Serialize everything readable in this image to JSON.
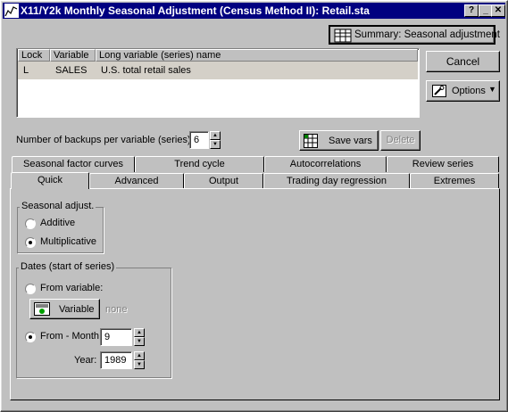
{
  "window": {
    "title": "X11/Y2k Monthly Seasonal Adjustment (Census Method II): Retail.sta",
    "help_btn": "?",
    "minimize_btn": "_",
    "close_btn": "✕"
  },
  "buttons": {
    "summary": "Summary:  Seasonal adjustment",
    "cancel": "Cancel",
    "options": "Options",
    "save_vars": "Save vars",
    "delete": "Delete",
    "variable": "Variable"
  },
  "table": {
    "headers": [
      "Lock",
      "Variable",
      "Long variable (series) name"
    ],
    "rows": [
      {
        "lock": "L",
        "variable": "SALES",
        "name": "U.S. total retail sales"
      }
    ]
  },
  "backups": {
    "label": "Number of backups per variable (series):",
    "value": "6"
  },
  "tabs_back": [
    "Seasonal factor curves",
    "Trend cycle",
    "Autocorrelations",
    "Review series"
  ],
  "tabs_front": [
    "Quick",
    "Advanced",
    "Output",
    "Trading day regression",
    "Extremes"
  ],
  "active_tab": "Quick",
  "seasonal": {
    "title": "Seasonal adjust.",
    "options": [
      "Additive",
      "Multiplicative"
    ],
    "selected": "Multiplicative"
  },
  "dates": {
    "title": "Dates (start of series)",
    "from_variable": "From variable:",
    "variable_value": "none",
    "from_month": "From - Month",
    "month_value": "9",
    "year_label": "Year:",
    "year_value": "1989",
    "selected": "From - Month"
  }
}
